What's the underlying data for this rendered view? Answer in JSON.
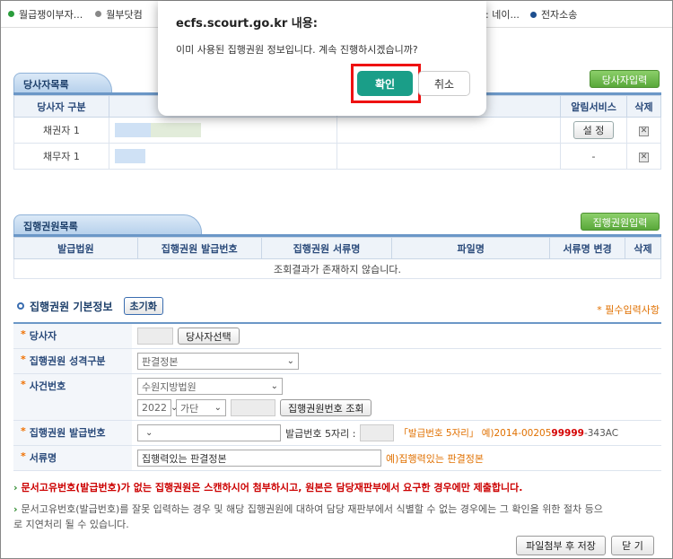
{
  "bookmarks": [
    {
      "label": "월급쟁이부자...",
      "color": "#2a9d3c"
    },
    {
      "label": "월부닷컴",
      "color": "#888888"
    },
    {
      "label": ": 네이...",
      "color": "#888888"
    },
    {
      "label": "전자소송",
      "color": "#1d4f8f"
    }
  ],
  "dialog": {
    "title": "ecfs.scourt.go.kr 내용:",
    "message": "이미 사용된 집행권원 정보입니다. 계속 진행하시겠습니까?",
    "ok_label": "확인",
    "cancel_label": "취소"
  },
  "parties": {
    "header": "당사자목록",
    "add_button": "당사자입력",
    "columns": [
      "당사자 구분",
      "",
      "",
      "알림서비스",
      "삭제"
    ],
    "rows": [
      {
        "type": "채권자 1",
        "alert": "설 정",
        "delete": "✕"
      },
      {
        "type": "채무자 1",
        "alert": "-",
        "delete": "✕"
      }
    ]
  },
  "titles": {
    "header": "집행권원목록",
    "add_button": "집행권원입력",
    "columns": [
      "발급법원",
      "집행권원 발급번호",
      "집행권원 서류명",
      "파일명",
      "서류명 변경",
      "삭제"
    ],
    "empty": "조회결과가 존재하지 않습니다."
  },
  "basic": {
    "title": "집행권원 기본정보",
    "reset_button": "초기화",
    "required_note": "* 필수입력사항",
    "party_label": "당사자",
    "party_button": "당사자선택",
    "nature_label": "집행권원 성격구분",
    "nature_value": "판결정본",
    "case_label": "사건번호",
    "court_value": "수원지방법원",
    "year_value": "2022",
    "case_type_value": "가단",
    "case_lookup_button": "집행권원번호 조회",
    "issue_label": "집행권원 발급번호",
    "issue_5digit_label": "발급번호 5자리 :",
    "issue_example_prefix": "「발급번호 5자리」 예)2014-00205",
    "issue_example_highlight": "99999",
    "issue_example_suffix": "-343AC",
    "doc_label": "서류명",
    "doc_value": "집행력있는 판결정본",
    "doc_example": "예)집행력있는 판결정본"
  },
  "notices": {
    "notice1": "문서고유번호(발급번호)가 없는 집행권원은 스캔하시어 첨부하시고, 원본은 담당재판부에서 요구한 경우에만 제출합니다.",
    "notice2_line1": "문서고유번호(발급번호)를 잘못 입력하는 경우 및 해당 집행권원에 대하여 담당 재판부에서 식별할 수 없는 경우에는 그 확인을 위한 절차 등으",
    "notice2_line2": "로 지연처리 될 수 있습니다."
  },
  "footer": {
    "save_button": "파일첨부 후 저장",
    "close_button": "닫 기"
  }
}
